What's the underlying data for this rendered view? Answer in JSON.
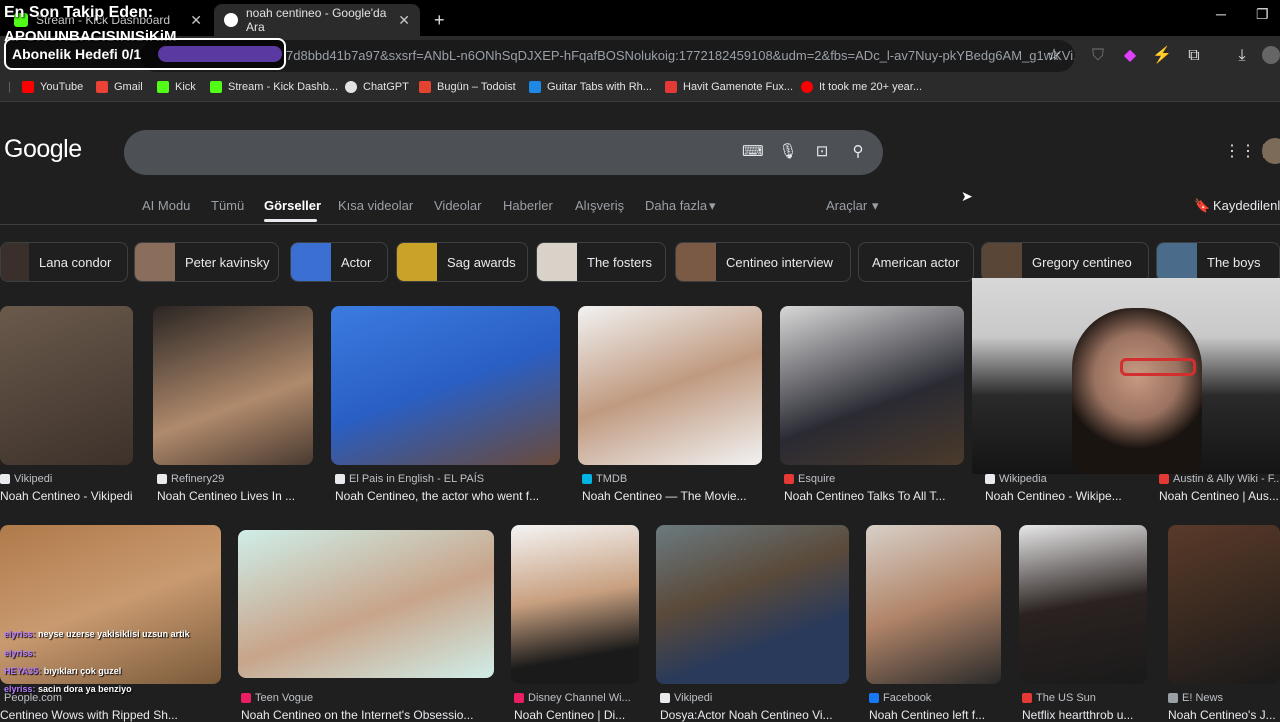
{
  "stream_overlay": {
    "follow_title": "En Son Takip Eden:",
    "follow_name": "APONUNBACISINISiKiM",
    "goal_label": "Abonelik Hedefi 0/1",
    "goal_progress": 0
  },
  "browser": {
    "tabs": [
      {
        "title": "Stream - Kick Dashboard",
        "active": false
      },
      {
        "title": "noah centineo - Google'da Ara",
        "active": true
      }
    ],
    "new_tab": "+",
    "url": "7d8bbd41b7a97&sxsrf=ANbL-n6ONhSqDJXEP-hFqafBOSNolukoig:1772182459108&udm=2&fbs=ADc_l-av7Nuy-pkYBedg6AM_g1wKVi...",
    "bookmarks": [
      {
        "label": "YouTube",
        "color": "#ff0000"
      },
      {
        "label": "Gmail",
        "color": "#ea4335"
      },
      {
        "label": "Kick",
        "color": "#53fc18"
      },
      {
        "label": "Stream - Kick Dashb...",
        "color": "#53fc18"
      },
      {
        "label": "ChatGPT",
        "color": "#e3e3e3"
      },
      {
        "label": "Bugün – Todoist",
        "color": "#e44332"
      },
      {
        "label": "Guitar Tabs with Rh...",
        "color": "#1e88e5"
      },
      {
        "label": "Havit Gamenote Fux...",
        "color": "#e53935"
      },
      {
        "label": "It took me 20+ year...",
        "color": "#ff0000"
      }
    ]
  },
  "google": {
    "logo": "Google",
    "nav_tabs": [
      "AI Modu",
      "Tümü",
      "Görseller",
      "Kısa videolar",
      "Videolar",
      "Haberler",
      "Alışveriş",
      "Daha fazla"
    ],
    "active_tab": "Görseller",
    "tools": "Araçlar",
    "saved": "Kaydedilenler",
    "chips": [
      "Lana condor",
      "Peter kavinsky",
      "Actor",
      "Sag awards",
      "The fosters",
      "Centineo interview",
      "American actor",
      "Gregory centineo",
      "The boys"
    ],
    "results_row1": [
      {
        "source": "Vikipedi",
        "title": "Noah Centineo - Vikipedi"
      },
      {
        "source": "Refinery29",
        "title": "Noah Centineo Lives In ..."
      },
      {
        "source": "El Pais in English - EL PAÍS",
        "title": "Noah Centineo, the actor who went f..."
      },
      {
        "source": "TMDB",
        "title": "Noah Centineo — The Movie..."
      },
      {
        "source": "Esquire",
        "title": "Noah Centineo Talks To All T..."
      },
      {
        "source": "Wikipedia",
        "title": "Noah Centineo - Wikipe..."
      },
      {
        "source": "Austin & Ally Wiki - F...",
        "title": "Noah Centineo | Aus..."
      }
    ],
    "results_row2": [
      {
        "source": "People.com",
        "title": "Centineo Wows with Ripped Sh..."
      },
      {
        "source": "Teen Vogue",
        "title": "Noah Centineo on the Internet's Obsessio..."
      },
      {
        "source": "Disney Channel Wi...",
        "title": "Noah Centineo | Di..."
      },
      {
        "source": "Vikipedi",
        "title": "Dosya:Actor Noah Centineo Vi..."
      },
      {
        "source": "Facebook",
        "title": "Noah Centineo left f..."
      },
      {
        "source": "The US Sun",
        "title": "Netflix heartthrob u..."
      },
      {
        "source": "E! News",
        "title": "Noah Centineo's J..."
      }
    ]
  },
  "chat": [
    {
      "user": "elyriss:",
      "text": "neyse uzerse yakisiklisi uzsun artik"
    },
    {
      "user": "elyriss:",
      "text": ""
    },
    {
      "user": "HEYA35:",
      "text": "bıyıkları çok guzel"
    },
    {
      "user": "elyriss:",
      "text": "sacin dora ya benziyo"
    }
  ]
}
